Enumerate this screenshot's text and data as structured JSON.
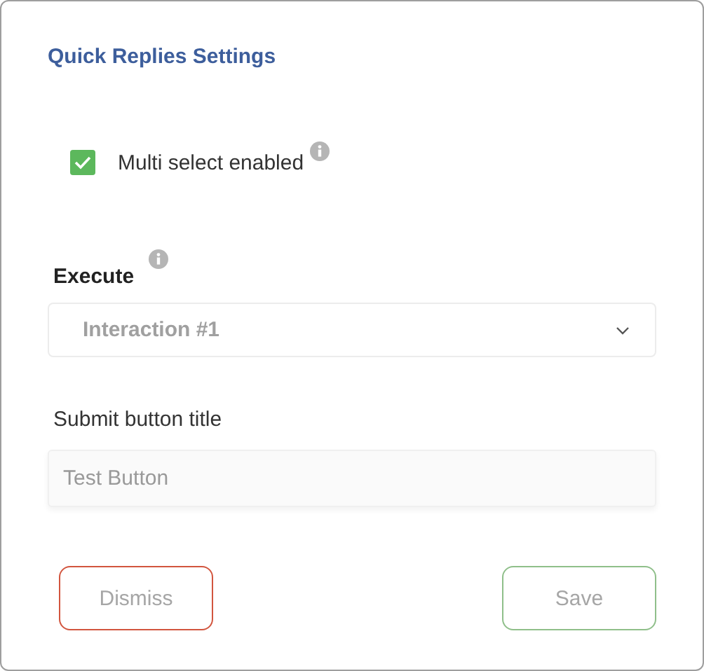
{
  "title": "Quick Replies Settings",
  "multi_select": {
    "label": "Multi select enabled",
    "checked": true
  },
  "execute": {
    "label": "Execute",
    "value": "Interaction #1"
  },
  "submit_title": {
    "label": "Submit button title",
    "value": "Test Button"
  },
  "buttons": [
    {
      "label": "Dismiss",
      "kind": "dismiss"
    },
    {
      "label": "Save",
      "kind": "save"
    }
  ]
}
